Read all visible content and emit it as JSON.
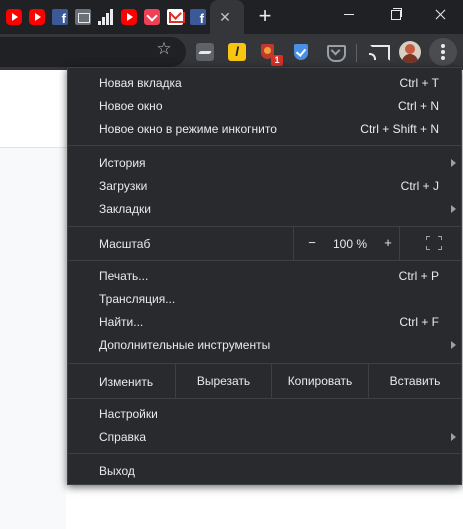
{
  "tab_strip": {
    "favicons": [
      "youtube-icon",
      "youtube-icon",
      "facebook-icon",
      "camera-icon",
      "signal-bars-icon",
      "youtube-icon",
      "pocket-icon",
      "gmail-icon",
      "facebook-icon"
    ],
    "close_glyph": "✕",
    "new_tab_glyph": "+",
    "facebook_letter": "f"
  },
  "toolbar": {
    "bookmark_glyph": "☆",
    "extensions": [
      "adblock-icon",
      "l-extension-icon",
      "ublock-icon",
      "shield-check-icon",
      "pocket-icon"
    ],
    "l_letter": "l",
    "ublock_badge": "1"
  },
  "menu": {
    "new_tab": {
      "label": "Новая вкладка",
      "shortcut": "Ctrl + T"
    },
    "new_window": {
      "label": "Новое окно",
      "shortcut": "Ctrl + N"
    },
    "incognito": {
      "label": "Новое окно в режиме инкогнито",
      "shortcut": "Ctrl + Shift + N"
    },
    "history": {
      "label": "История"
    },
    "downloads": {
      "label": "Загрузки",
      "shortcut": "Ctrl + J"
    },
    "bookmarks": {
      "label": "Закладки"
    },
    "zoom": {
      "label": "Масштаб",
      "minus": "−",
      "value": "100 %",
      "plus": "+"
    },
    "print": {
      "label": "Печать...",
      "shortcut": "Ctrl + P"
    },
    "cast": {
      "label": "Трансляция..."
    },
    "find": {
      "label": "Найти...",
      "shortcut": "Ctrl + F"
    },
    "more_tools": {
      "label": "Дополнительные инструменты"
    },
    "edit": {
      "label": "Изменить",
      "cut": "Вырезать",
      "copy": "Копировать",
      "paste": "Вставить"
    },
    "settings": {
      "label": "Настройки"
    },
    "help": {
      "label": "Справка"
    },
    "exit": {
      "label": "Выход"
    }
  },
  "colors": {
    "frame": "#202124",
    "toolbar": "#35363a",
    "menu_bg": "#292a2d",
    "menu_text": "#e8eaed",
    "separator": "#3c4043"
  }
}
